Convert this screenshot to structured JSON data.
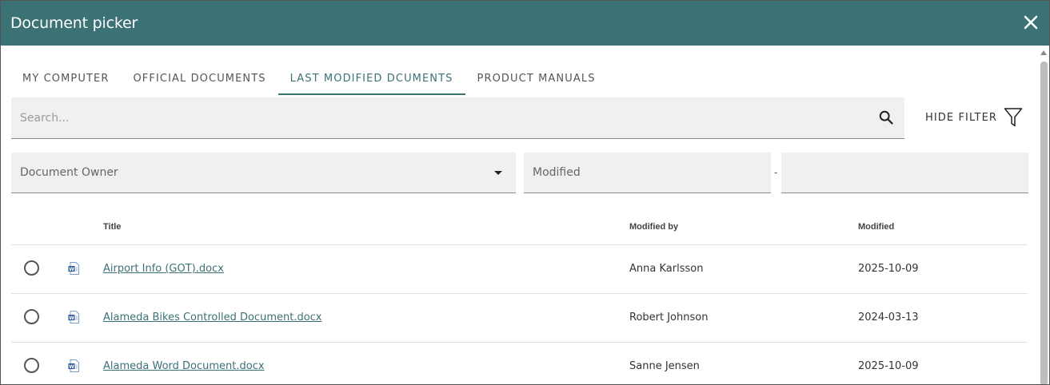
{
  "dialog": {
    "title": "Document picker"
  },
  "tabs": [
    {
      "label": "MY COMPUTER",
      "active": false
    },
    {
      "label": "OFFICIAL DOCUMENTS",
      "active": false
    },
    {
      "label": "LAST MODIFIED DCUMENTS",
      "active": true
    },
    {
      "label": "PRODUCT MANUALS",
      "active": false
    }
  ],
  "search": {
    "placeholder": "Search...",
    "value": ""
  },
  "filter": {
    "toggle_label": "HIDE FILTER"
  },
  "filters": {
    "owner_label": "Document Owner",
    "modified_label": "Modified",
    "range_separator": "-",
    "modified_to_value": ""
  },
  "table": {
    "columns": {
      "title": "Title",
      "modified_by": "Modified by",
      "modified": "Modified"
    },
    "rows": [
      {
        "title": "Airport Info (GOT).docx",
        "modified_by": "Anna Karlsson",
        "modified": "2025-10-09",
        "file_type": "word-doc-icon"
      },
      {
        "title": "Alameda Bikes Controlled Document.docx",
        "modified_by": "Robert Johnson",
        "modified": "2024-03-13",
        "file_type": "word-doc-icon"
      },
      {
        "title": "Alameda Word Document.docx",
        "modified_by": "Sanne Jensen",
        "modified": "2025-10-09",
        "file_type": "word-doc-icon"
      }
    ]
  },
  "colors": {
    "header": "#3b7275",
    "accent": "#3b7275",
    "field_bg": "#f0f0f0"
  }
}
